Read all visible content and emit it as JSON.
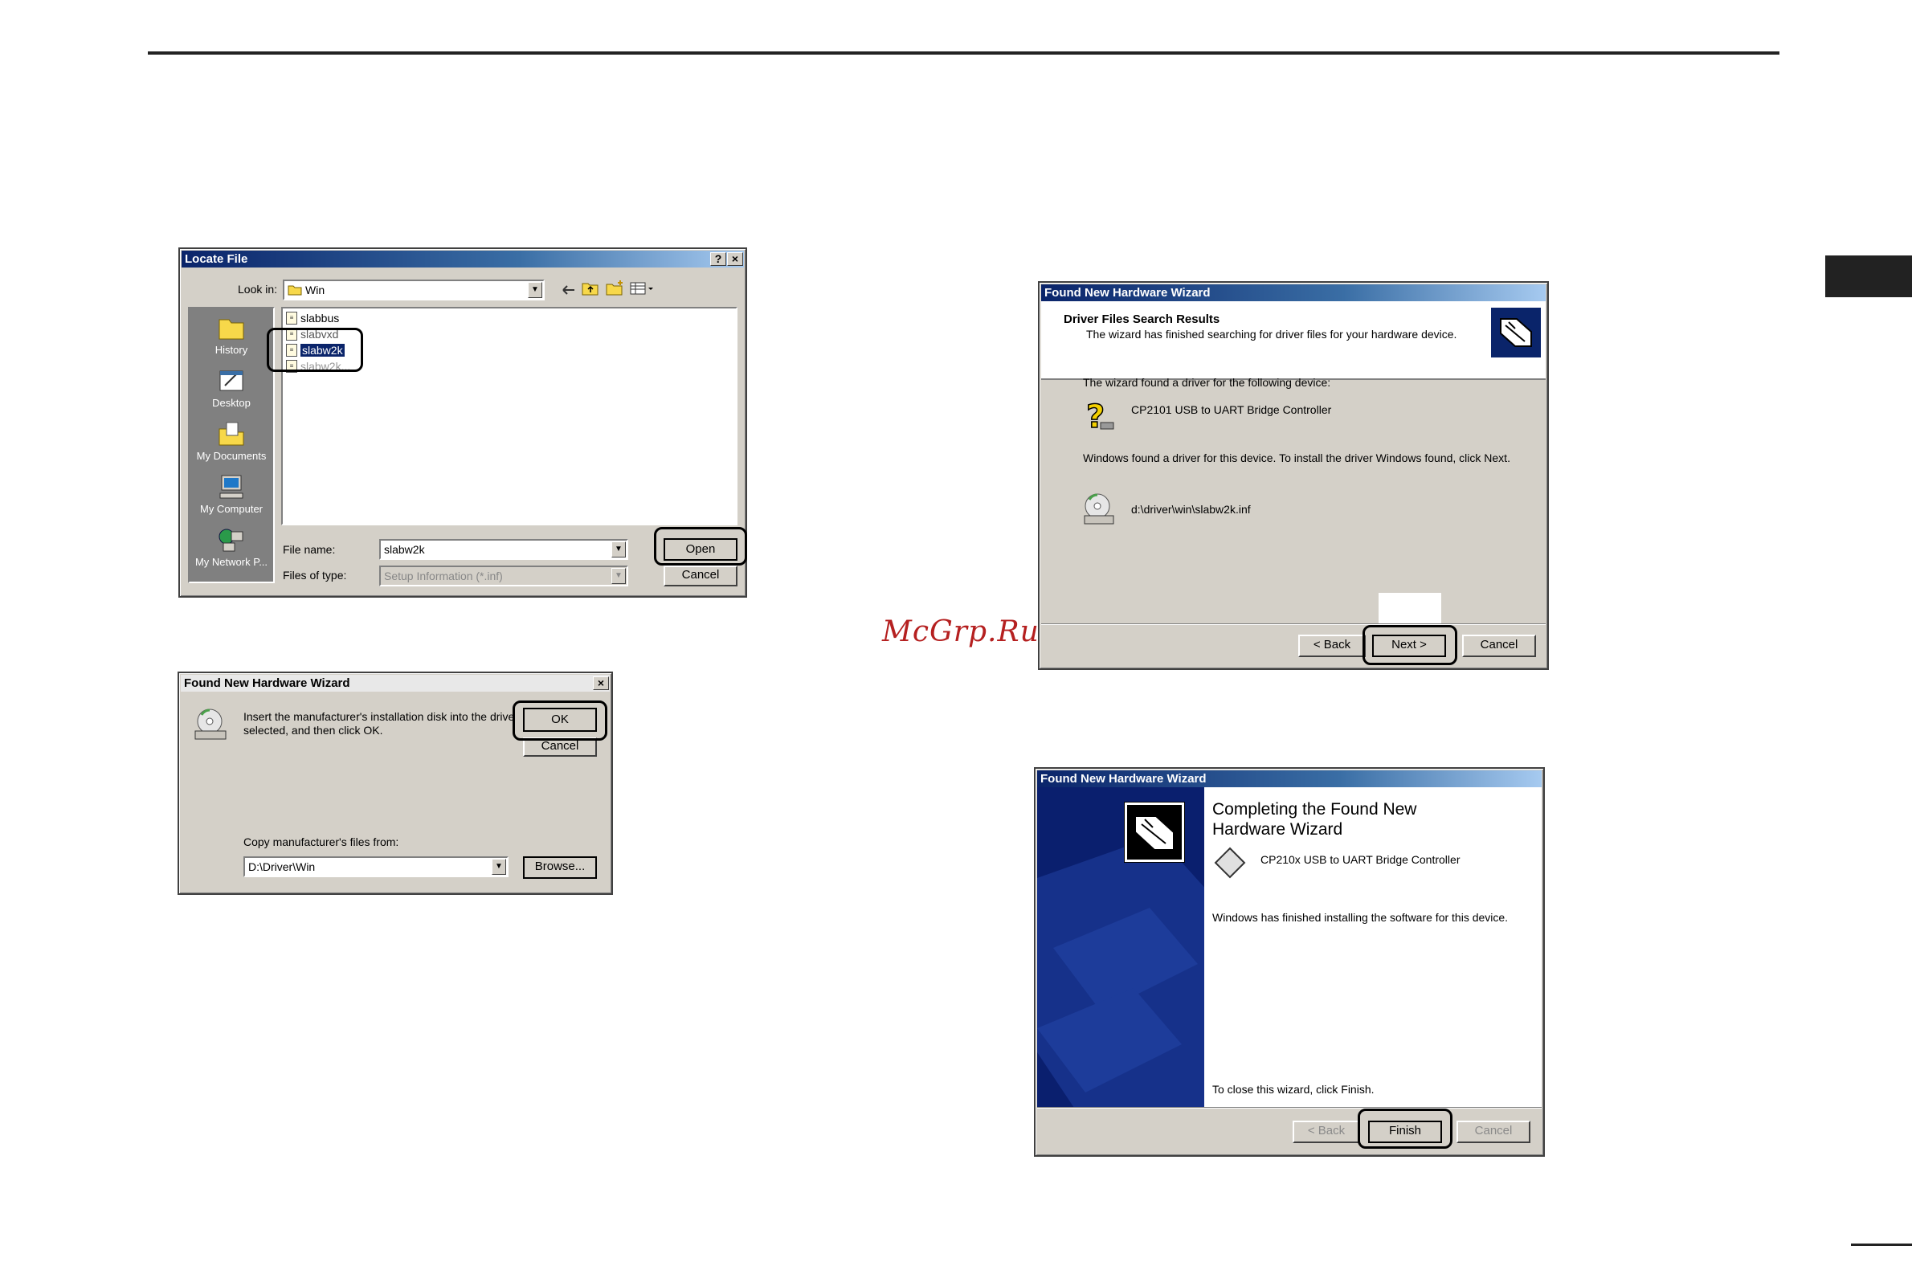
{
  "watermark": "McGrp.Ru",
  "locate_file": {
    "title": "Locate File",
    "help_btn": "?",
    "close_btn": "×",
    "look_in_label": "Look in:",
    "look_in_value": "Win",
    "places": [
      "History",
      "Desktop",
      "My Documents",
      "My Computer",
      "My Network P..."
    ],
    "files": [
      "slabbus",
      "slabvxd",
      "slabw2k",
      "slabw2k..."
    ],
    "selected_file": "slabw2k",
    "file_name_label": "File name:",
    "file_name_value": "slabw2k",
    "files_of_type_label": "Files of type:",
    "files_of_type_value": "Setup Information (*.inf)",
    "open_btn": "Open",
    "cancel_btn": "Cancel"
  },
  "insert_disk": {
    "title": "Found New Hardware Wizard",
    "close_btn": "×",
    "message_line1": "Insert the manufacturer's installation disk into the drive",
    "message_line2": "selected, and then click OK.",
    "ok_btn": "OK",
    "cancel_btn": "Cancel",
    "copy_label": "Copy manufacturer's files from:",
    "copy_value": "D:\\Driver\\Win",
    "browse_btn": "Browse..."
  },
  "search_results": {
    "title": "Found New Hardware Wizard",
    "header_title": "Driver Files Search Results",
    "header_subtitle": "The wizard has finished searching for driver files for your hardware device.",
    "found_text": "The wizard found a driver for the following device:",
    "device_name": "CP2101 USB to UART Bridge Controller",
    "install_text": "Windows found a driver for this device. To install the driver Windows found, click Next.",
    "driver_path": "d:\\driver\\win\\slabw2k.inf",
    "back_btn": "< Back",
    "next_btn": "Next >",
    "cancel_btn": "Cancel"
  },
  "completing": {
    "title": "Found New Hardware Wizard",
    "heading_line1": "Completing the Found New",
    "heading_line2": "Hardware Wizard",
    "device_name": "CP210x USB to UART Bridge Controller",
    "finished_text": "Windows has finished installing the software for this device.",
    "close_text": "To close this wizard, click Finish.",
    "back_btn": "< Back",
    "finish_btn": "Finish",
    "cancel_btn": "Cancel"
  },
  "colors": {
    "title_gradient_start": "#0a246a",
    "dialog_face": "#d4d0c8",
    "wizard_side_panel": "#0a1f6e",
    "watermark": "#b52020"
  }
}
